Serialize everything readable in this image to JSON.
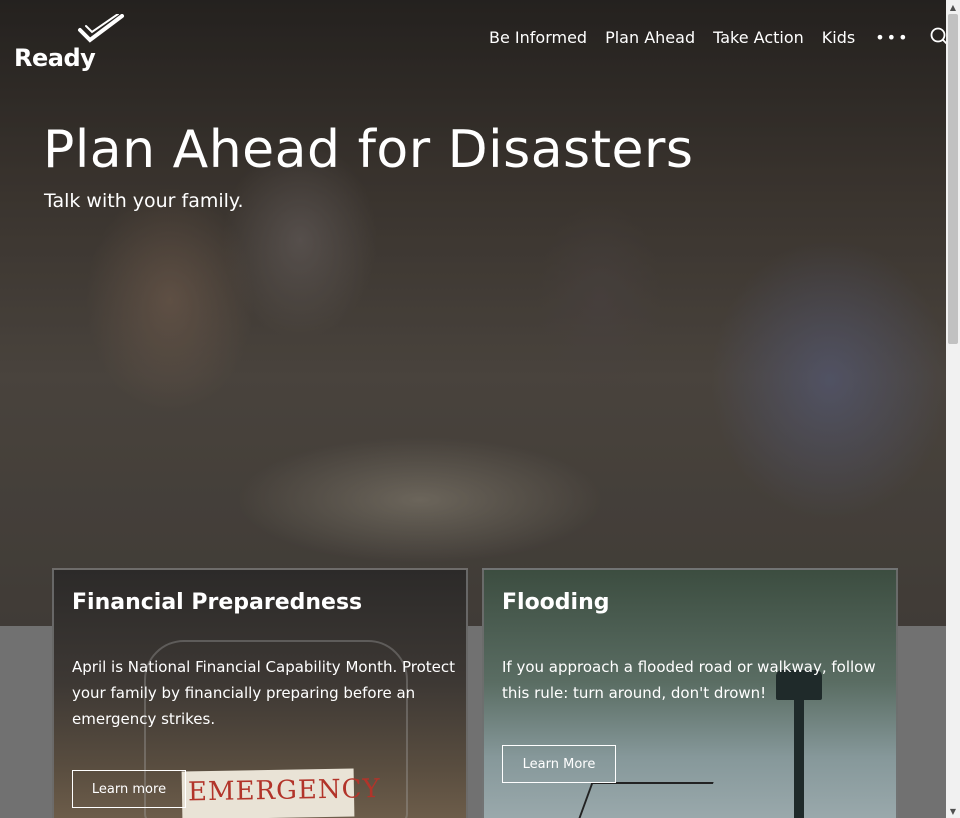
{
  "brand": {
    "name": "Ready",
    "logo_icon": "checkmark-swoosh-icon"
  },
  "nav": {
    "items": [
      "Be Informed",
      "Plan Ahead",
      "Take Action",
      "Kids"
    ],
    "more_label": "•••",
    "search_icon": "search-icon"
  },
  "hero": {
    "title": "Plan Ahead for Disasters",
    "subtitle": "Talk with your family."
  },
  "cards": [
    {
      "title": "Financial Preparedness",
      "description": "April is National Financial Capability Month. Protect your family by financially preparing before an emergency strikes.",
      "button": "Learn more",
      "image_text": "EMERGENCY"
    },
    {
      "title": "Flooding",
      "description": "If you approach a flooded road or walkway, follow this rule: turn around, don't drown!",
      "button": "Learn More"
    }
  ],
  "colors": {
    "overlay": "#2a2624",
    "emergency_text": "#b2342a",
    "scrollbar": "#f1f1f1"
  }
}
